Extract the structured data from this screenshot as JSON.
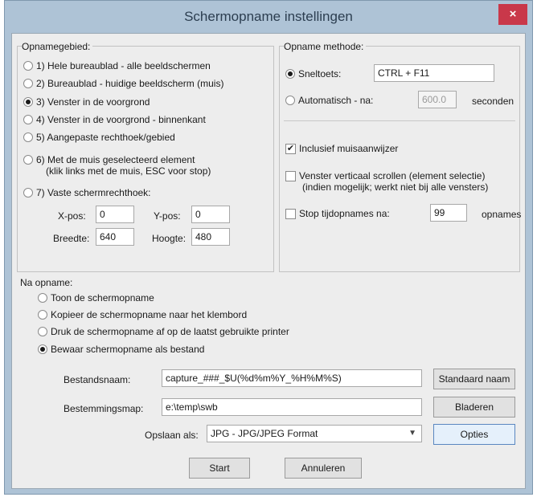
{
  "window": {
    "title": "Schermopname instellingen",
    "close_label": "×"
  },
  "area": {
    "label": "Opnamegebied:",
    "options": [
      "1) Hele bureaublad - alle beeldschermen",
      "2) Bureaublad - huidige beeldscherm (muis)",
      "3) Venster in de voorgrond",
      "4) Venster in de voorgrond - binnenkant",
      "5) Aangepaste rechthoek/gebied",
      "6) Met de muis geselecteerd element",
      "7) Vaste schermrechthoek:"
    ],
    "option6_line2": "(klik links met de muis, ESC voor stop)",
    "selected": 3,
    "xpos_label": "X-pos:",
    "xpos_value": "0",
    "ypos_label": "Y-pos:",
    "ypos_value": "0",
    "breedte_label": "Breedte:",
    "breedte_value": "640",
    "hoogte_label": "Hoogte:",
    "hoogte_value": "480"
  },
  "method": {
    "label": "Opname methode:",
    "hotkey_label": "Sneltoets:",
    "hotkey_value": "CTRL + F11",
    "auto_label": "Automatisch - na:",
    "auto_value": "600.0",
    "auto_unit": "seconden",
    "selected": "hotkey"
  },
  "extras": {
    "cursor_label": "Inclusief muisaanwijzer",
    "cursor_checked": true,
    "scroll_label": "Venster verticaal scrollen (element selectie)",
    "scroll_line2": "(indien mogelijk; werkt niet bij alle vensters)",
    "scroll_checked": false,
    "stop_label": "Stop tijdopnames na:",
    "stop_value": "99",
    "stop_unit": "opnames",
    "stop_checked": false,
    "check_mark": "✔"
  },
  "after": {
    "label": "Na opname:",
    "options": [
      "Toon de schermopname",
      "Kopieer de schermopname naar het klembord",
      "Druk de schermopname af op de laatst gebruikte printer",
      "Bewaar schermopname als bestand"
    ],
    "selected": 4
  },
  "file": {
    "filename_label": "Bestandsnaam:",
    "filename_value": "capture_###_$U(%d%m%Y_%H%M%S)",
    "default_name_button": "Standaard naam",
    "folder_label": "Bestemmingsmap:",
    "folder_value": "e:\\temp\\swb",
    "browse_button": "Bladeren",
    "save_as_label": "Opslaan als:",
    "save_as_value": "JPG - JPG/JPEG Format",
    "options_button": "Opties"
  },
  "buttons": {
    "start": "Start",
    "cancel": "Annuleren"
  }
}
